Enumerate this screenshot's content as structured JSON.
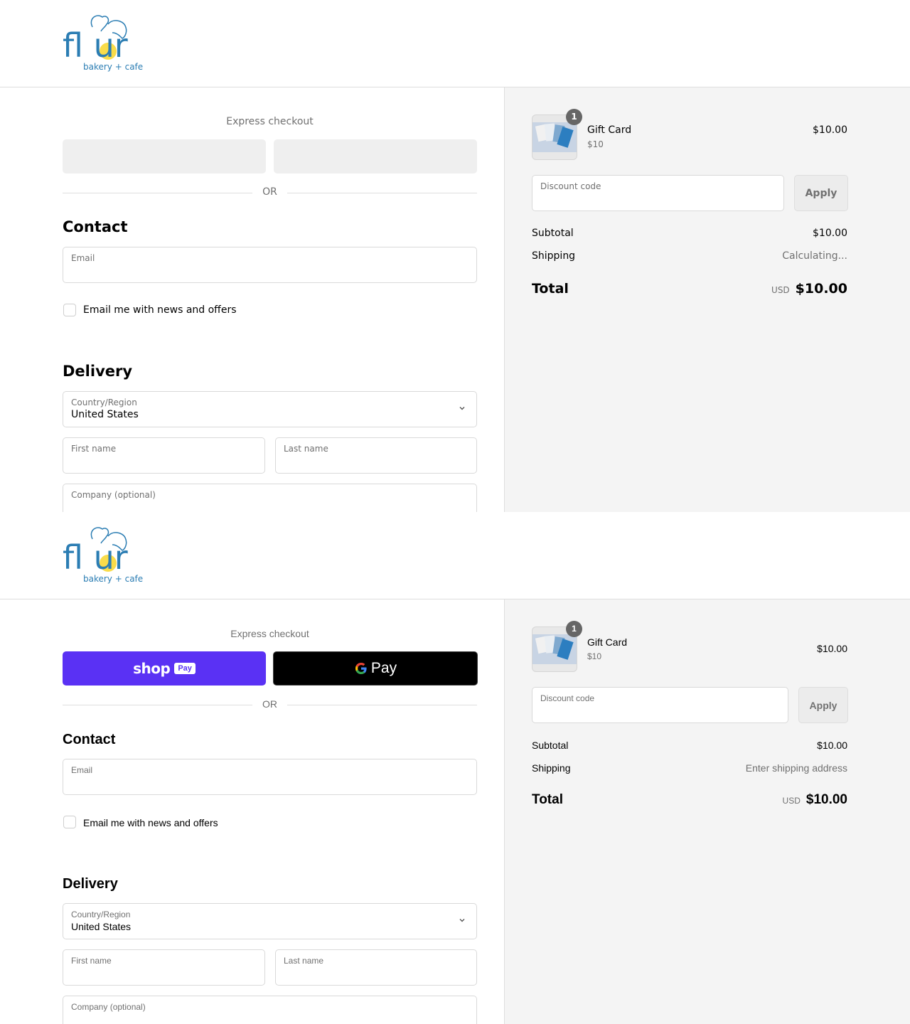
{
  "frames": [
    {
      "logo": {
        "wordmark": "fl ur",
        "tagline": "bakery + cafe"
      },
      "express_checkout": {
        "title": "Express checkout"
      },
      "divider_text": "OR",
      "contact": {
        "heading": "Contact",
        "email_label": "Email",
        "newsletter_label": "Email me with news and offers"
      },
      "delivery": {
        "heading": "Delivery",
        "country_label": "Country/Region",
        "country_value": "United States",
        "first_name_label": "First name",
        "last_name_label": "Last name",
        "company_label": "Company (optional)"
      },
      "summary": {
        "quantity": "1",
        "item_name": "Gift Card",
        "item_variant": "$10",
        "item_price": "$10.00",
        "discount_label": "Discount code",
        "apply_label": "Apply",
        "subtotal_label": "Subtotal",
        "subtotal_value": "$10.00",
        "shipping_label": "Shipping",
        "shipping_value": "Calculating...",
        "total_label": "Total",
        "currency": "USD",
        "total_value": "$10.00"
      }
    },
    {
      "logo": {
        "wordmark": "fl ur",
        "tagline": "bakery + cafe"
      },
      "express_checkout": {
        "title": "Express checkout",
        "shop_word": "shop",
        "shop_pay": "Pay",
        "gpay_word": "Pay"
      },
      "divider_text": "OR",
      "contact": {
        "heading": "Contact",
        "email_label": "Email",
        "newsletter_label": "Email me with news and offers"
      },
      "delivery": {
        "heading": "Delivery",
        "country_label": "Country/Region",
        "country_value": "United States",
        "first_name_label": "First name",
        "last_name_label": "Last name",
        "company_label": "Company (optional)"
      },
      "summary": {
        "quantity": "1",
        "item_name": "Gift Card",
        "item_variant": "$10",
        "item_price": "$10.00",
        "discount_label": "Discount code",
        "apply_label": "Apply",
        "subtotal_label": "Subtotal",
        "subtotal_value": "$10.00",
        "shipping_label": "Shipping",
        "shipping_value": "Enter shipping address",
        "total_label": "Total",
        "currency": "USD",
        "total_value": "$10.00"
      }
    }
  ],
  "colors": {
    "brand_blue": "#2b7db3",
    "brand_yellow": "#f9dc4a",
    "shop_pay": "#5a31f4",
    "gpay": "#000000"
  }
}
